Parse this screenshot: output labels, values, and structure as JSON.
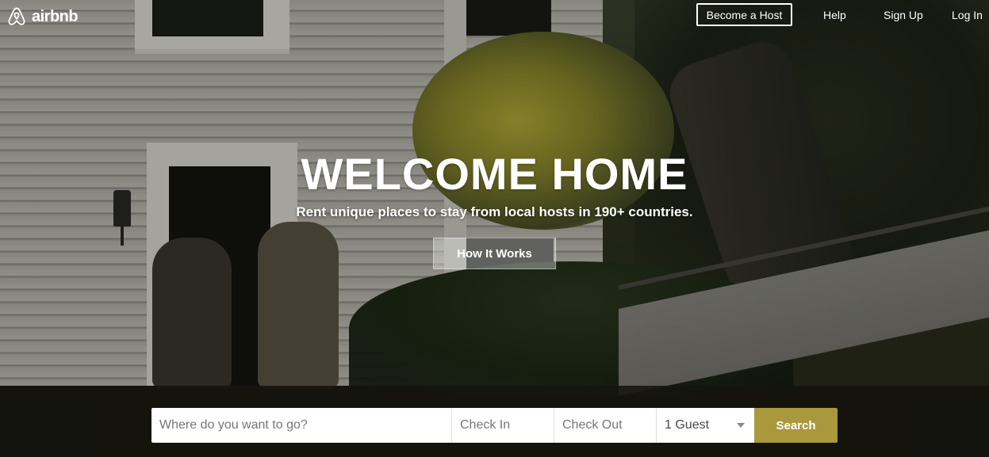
{
  "brand": {
    "name": "airbnb",
    "logo_icon": "airbnb-belo-icon"
  },
  "nav": {
    "become_host": "Become a Host",
    "help": "Help",
    "sign_up": "Sign Up",
    "log_in": "Log In"
  },
  "hero": {
    "title": "WELCOME HOME",
    "subtitle": "Rent unique places to stay from local hosts in 190+ countries.",
    "cta": "How It Works"
  },
  "search": {
    "where_placeholder": "Where do you want to go?",
    "checkin_placeholder": "Check In",
    "checkout_placeholder": "Check Out",
    "guests_value": "1 Guest",
    "button_label": "Search"
  },
  "colors": {
    "search_button": "#a9993c",
    "text_on_hero": "#ffffff"
  }
}
